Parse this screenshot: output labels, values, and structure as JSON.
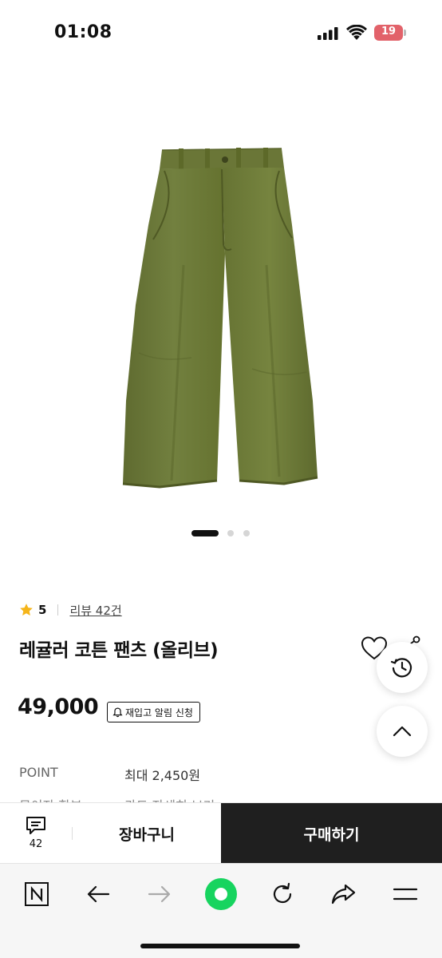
{
  "status_bar": {
    "time": "01:08",
    "battery": "19"
  },
  "product": {
    "rating": "5",
    "review_link": "리뷰 42건",
    "title": "레귤러 코튼 팬츠 (올리브)",
    "price": "49,000",
    "restock_label": "재입고 알림 신청",
    "image_slides": 3,
    "active_slide": 1
  },
  "benefits": {
    "point_label": "POINT",
    "point_value": "최대 2,450원",
    "cutoff_label": "무이자 할부",
    "cutoff_value": "카드 자세히 보기"
  },
  "purchase_bar": {
    "comment_count": "42",
    "cart_label": "장바구니",
    "buy_label": "구매하기"
  },
  "browser_toolbar": {
    "items": [
      "naver-home-icon",
      "back-arrow-icon",
      "forward-arrow-icon",
      "green-circle-icon",
      "reload-icon",
      "share-icon",
      "menu-icon"
    ]
  },
  "colors": {
    "accent_green": "#17d45f",
    "buy_button": "#1f1f1f",
    "star": "#f5b51a",
    "pants_olive": "#6e7a3c",
    "battery": "#e2626a"
  }
}
